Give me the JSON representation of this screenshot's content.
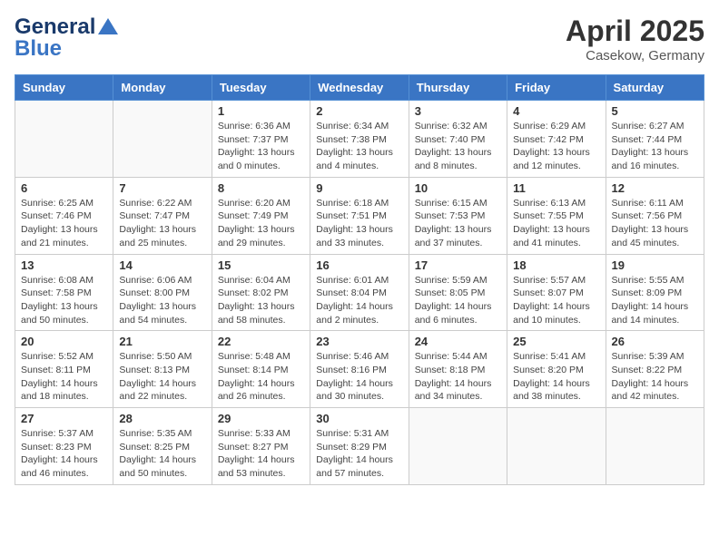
{
  "header": {
    "logo_line1": "General",
    "logo_line2": "Blue",
    "month_title": "April 2025",
    "subtitle": "Casekow, Germany"
  },
  "weekdays": [
    "Sunday",
    "Monday",
    "Tuesday",
    "Wednesday",
    "Thursday",
    "Friday",
    "Saturday"
  ],
  "weeks": [
    [
      {
        "day": "",
        "info": ""
      },
      {
        "day": "",
        "info": ""
      },
      {
        "day": "1",
        "info": "Sunrise: 6:36 AM\nSunset: 7:37 PM\nDaylight: 13 hours and 0 minutes."
      },
      {
        "day": "2",
        "info": "Sunrise: 6:34 AM\nSunset: 7:38 PM\nDaylight: 13 hours and 4 minutes."
      },
      {
        "day": "3",
        "info": "Sunrise: 6:32 AM\nSunset: 7:40 PM\nDaylight: 13 hours and 8 minutes."
      },
      {
        "day": "4",
        "info": "Sunrise: 6:29 AM\nSunset: 7:42 PM\nDaylight: 13 hours and 12 minutes."
      },
      {
        "day": "5",
        "info": "Sunrise: 6:27 AM\nSunset: 7:44 PM\nDaylight: 13 hours and 16 minutes."
      }
    ],
    [
      {
        "day": "6",
        "info": "Sunrise: 6:25 AM\nSunset: 7:46 PM\nDaylight: 13 hours and 21 minutes."
      },
      {
        "day": "7",
        "info": "Sunrise: 6:22 AM\nSunset: 7:47 PM\nDaylight: 13 hours and 25 minutes."
      },
      {
        "day": "8",
        "info": "Sunrise: 6:20 AM\nSunset: 7:49 PM\nDaylight: 13 hours and 29 minutes."
      },
      {
        "day": "9",
        "info": "Sunrise: 6:18 AM\nSunset: 7:51 PM\nDaylight: 13 hours and 33 minutes."
      },
      {
        "day": "10",
        "info": "Sunrise: 6:15 AM\nSunset: 7:53 PM\nDaylight: 13 hours and 37 minutes."
      },
      {
        "day": "11",
        "info": "Sunrise: 6:13 AM\nSunset: 7:55 PM\nDaylight: 13 hours and 41 minutes."
      },
      {
        "day": "12",
        "info": "Sunrise: 6:11 AM\nSunset: 7:56 PM\nDaylight: 13 hours and 45 minutes."
      }
    ],
    [
      {
        "day": "13",
        "info": "Sunrise: 6:08 AM\nSunset: 7:58 PM\nDaylight: 13 hours and 50 minutes."
      },
      {
        "day": "14",
        "info": "Sunrise: 6:06 AM\nSunset: 8:00 PM\nDaylight: 13 hours and 54 minutes."
      },
      {
        "day": "15",
        "info": "Sunrise: 6:04 AM\nSunset: 8:02 PM\nDaylight: 13 hours and 58 minutes."
      },
      {
        "day": "16",
        "info": "Sunrise: 6:01 AM\nSunset: 8:04 PM\nDaylight: 14 hours and 2 minutes."
      },
      {
        "day": "17",
        "info": "Sunrise: 5:59 AM\nSunset: 8:05 PM\nDaylight: 14 hours and 6 minutes."
      },
      {
        "day": "18",
        "info": "Sunrise: 5:57 AM\nSunset: 8:07 PM\nDaylight: 14 hours and 10 minutes."
      },
      {
        "day": "19",
        "info": "Sunrise: 5:55 AM\nSunset: 8:09 PM\nDaylight: 14 hours and 14 minutes."
      }
    ],
    [
      {
        "day": "20",
        "info": "Sunrise: 5:52 AM\nSunset: 8:11 PM\nDaylight: 14 hours and 18 minutes."
      },
      {
        "day": "21",
        "info": "Sunrise: 5:50 AM\nSunset: 8:13 PM\nDaylight: 14 hours and 22 minutes."
      },
      {
        "day": "22",
        "info": "Sunrise: 5:48 AM\nSunset: 8:14 PM\nDaylight: 14 hours and 26 minutes."
      },
      {
        "day": "23",
        "info": "Sunrise: 5:46 AM\nSunset: 8:16 PM\nDaylight: 14 hours and 30 minutes."
      },
      {
        "day": "24",
        "info": "Sunrise: 5:44 AM\nSunset: 8:18 PM\nDaylight: 14 hours and 34 minutes."
      },
      {
        "day": "25",
        "info": "Sunrise: 5:41 AM\nSunset: 8:20 PM\nDaylight: 14 hours and 38 minutes."
      },
      {
        "day": "26",
        "info": "Sunrise: 5:39 AM\nSunset: 8:22 PM\nDaylight: 14 hours and 42 minutes."
      }
    ],
    [
      {
        "day": "27",
        "info": "Sunrise: 5:37 AM\nSunset: 8:23 PM\nDaylight: 14 hours and 46 minutes."
      },
      {
        "day": "28",
        "info": "Sunrise: 5:35 AM\nSunset: 8:25 PM\nDaylight: 14 hours and 50 minutes."
      },
      {
        "day": "29",
        "info": "Sunrise: 5:33 AM\nSunset: 8:27 PM\nDaylight: 14 hours and 53 minutes."
      },
      {
        "day": "30",
        "info": "Sunrise: 5:31 AM\nSunset: 8:29 PM\nDaylight: 14 hours and 57 minutes."
      },
      {
        "day": "",
        "info": ""
      },
      {
        "day": "",
        "info": ""
      },
      {
        "day": "",
        "info": ""
      }
    ]
  ]
}
